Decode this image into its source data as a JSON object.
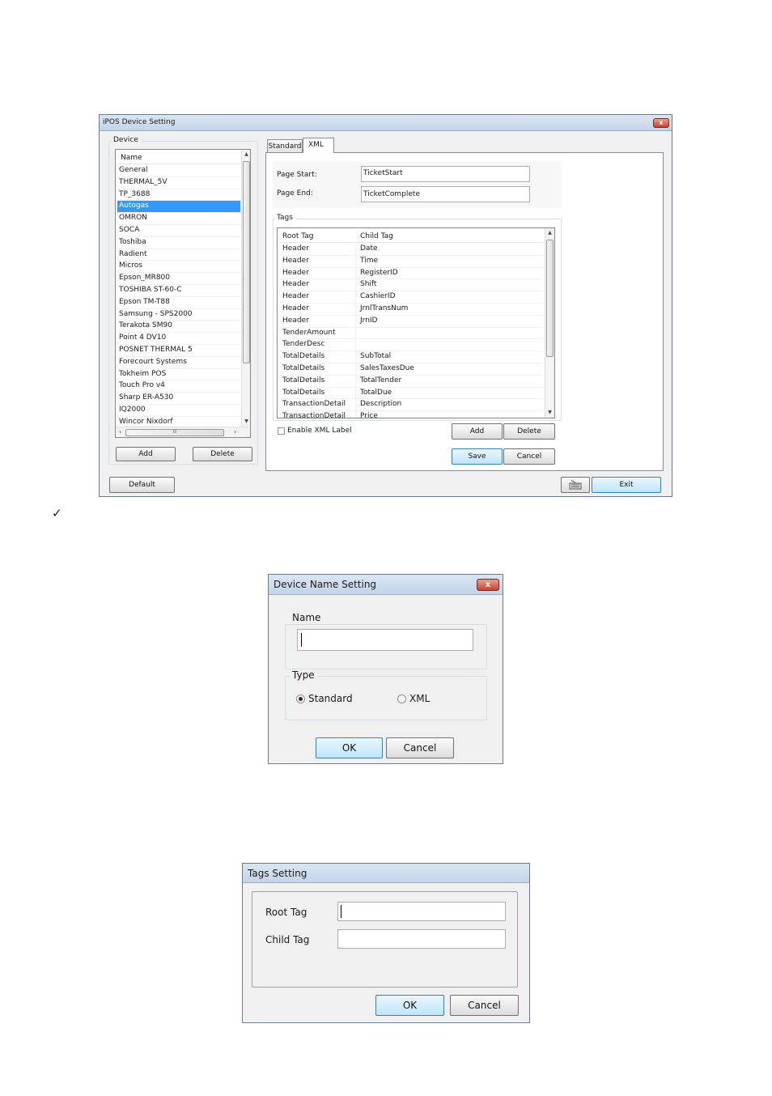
{
  "device_setting": {
    "title": "iPOS Device Setting",
    "close_glyph": "x",
    "device_group_label": "Device",
    "list_header": "Name",
    "devices": [
      "General",
      "THERMAL_5V",
      "TP_3688",
      "Autogas",
      "OMRON",
      "SOCA",
      "Toshiba",
      "Radient",
      "Micros",
      "Epson_MR800",
      "TOSHIBA ST-60-C",
      "Epson TM-T88",
      "Samsung - SPS2000",
      "Terakota SM90",
      "Point 4 DV10",
      "POSNET THERMAL 5",
      "Forecourt Systems",
      "Tokheim POS",
      "Touch Pro v4",
      "Sharp ER-A530",
      "IQ2000",
      "Wincor Nixdorf"
    ],
    "selected_index": 3,
    "hscroll_thumb_glyph": "III",
    "add_label": "Add",
    "delete_label": "Delete",
    "default_label": "Default",
    "exit_label": "Exit",
    "keyboard_icon": "keyboard-icon",
    "tabs": [
      "Standard",
      "XML"
    ],
    "active_tab": "XML",
    "page_start_label": "Page Start:",
    "page_start_value": "TicketStart",
    "page_end_label": "Page End:",
    "page_end_value": "TicketComplete",
    "tags_group_label": "Tags",
    "tags_columns": [
      "Root Tag",
      "Child Tag"
    ],
    "tags_rows": [
      [
        "Header",
        "Date"
      ],
      [
        "Header",
        "Time"
      ],
      [
        "Header",
        "RegisterID"
      ],
      [
        "Header",
        "Shift"
      ],
      [
        "Header",
        "CashierID"
      ],
      [
        "Header",
        "JrnlTransNum"
      ],
      [
        "Header",
        "JrnID"
      ],
      [
        "TenderAmount",
        ""
      ],
      [
        "TenderDesc",
        ""
      ],
      [
        "TotalDetails",
        "SubTotal"
      ],
      [
        "TotalDetails",
        "SalesTaxesDue"
      ],
      [
        "TotalDetails",
        "TotalTender"
      ],
      [
        "TotalDetails",
        "TotalDue"
      ],
      [
        "TransactionDetail",
        "Description"
      ],
      [
        "TransactionDetail",
        "Price"
      ]
    ],
    "enable_xml_label": "Enable XML Label",
    "tags_add_label": "Add",
    "tags_delete_label": "Delete",
    "save_label": "Save",
    "cancel_label": "Cancel"
  },
  "checkmark": "✓",
  "device_name_dialog": {
    "title": "Device Name Setting",
    "close_glyph": "x",
    "name_group_label": "Name",
    "name_value": "",
    "type_group_label": "Type",
    "options": [
      "Standard",
      "XML"
    ],
    "selected_option": "Standard",
    "ok_label": "OK",
    "cancel_label": "Cancel"
  },
  "tags_dialog": {
    "title": "Tags Setting",
    "root_tag_label": "Root Tag",
    "root_tag_value": "",
    "child_tag_label": "Child Tag",
    "child_tag_value": "",
    "ok_label": "OK",
    "cancel_label": "Cancel"
  },
  "colors": {
    "selection": "#3399ff",
    "title_gradient_top": "#dbe6f3",
    "close_red": "#c7412c",
    "primary_button_border": "#3c7fb1"
  }
}
